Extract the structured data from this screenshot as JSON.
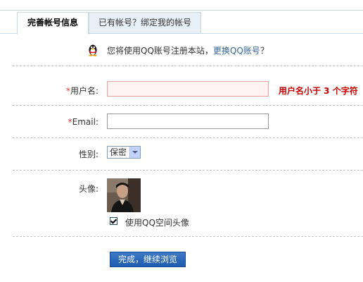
{
  "tabs": [
    {
      "label": "完善帐号信息",
      "active": true
    },
    {
      "label": "已有帐号？绑定我的帐号",
      "active": false
    }
  ],
  "notice": {
    "text_before": "您将使用QQ账号注册本站，",
    "link": "更换QQ账号",
    "text_after": "？"
  },
  "form": {
    "username_required_mark": "*",
    "username_label": "用户名:",
    "username_value": "",
    "username_error": "用户名小于 3 个字符",
    "email_required_mark": "*",
    "email_label": "Email:",
    "email_value": "",
    "gender_label": "性别:",
    "gender_selected": "保密",
    "avatar_label": "头像:",
    "use_qq_avatar_label": "使用QQ空间头像",
    "use_qq_avatar_checked": true,
    "submit_label": "完成，继续浏览"
  },
  "colors": {
    "error_red": "#cc0000",
    "required_red": "#e53333",
    "link_blue": "#336699",
    "button_blue": "#2a6abf",
    "tab_border": "#c9d9e6"
  }
}
